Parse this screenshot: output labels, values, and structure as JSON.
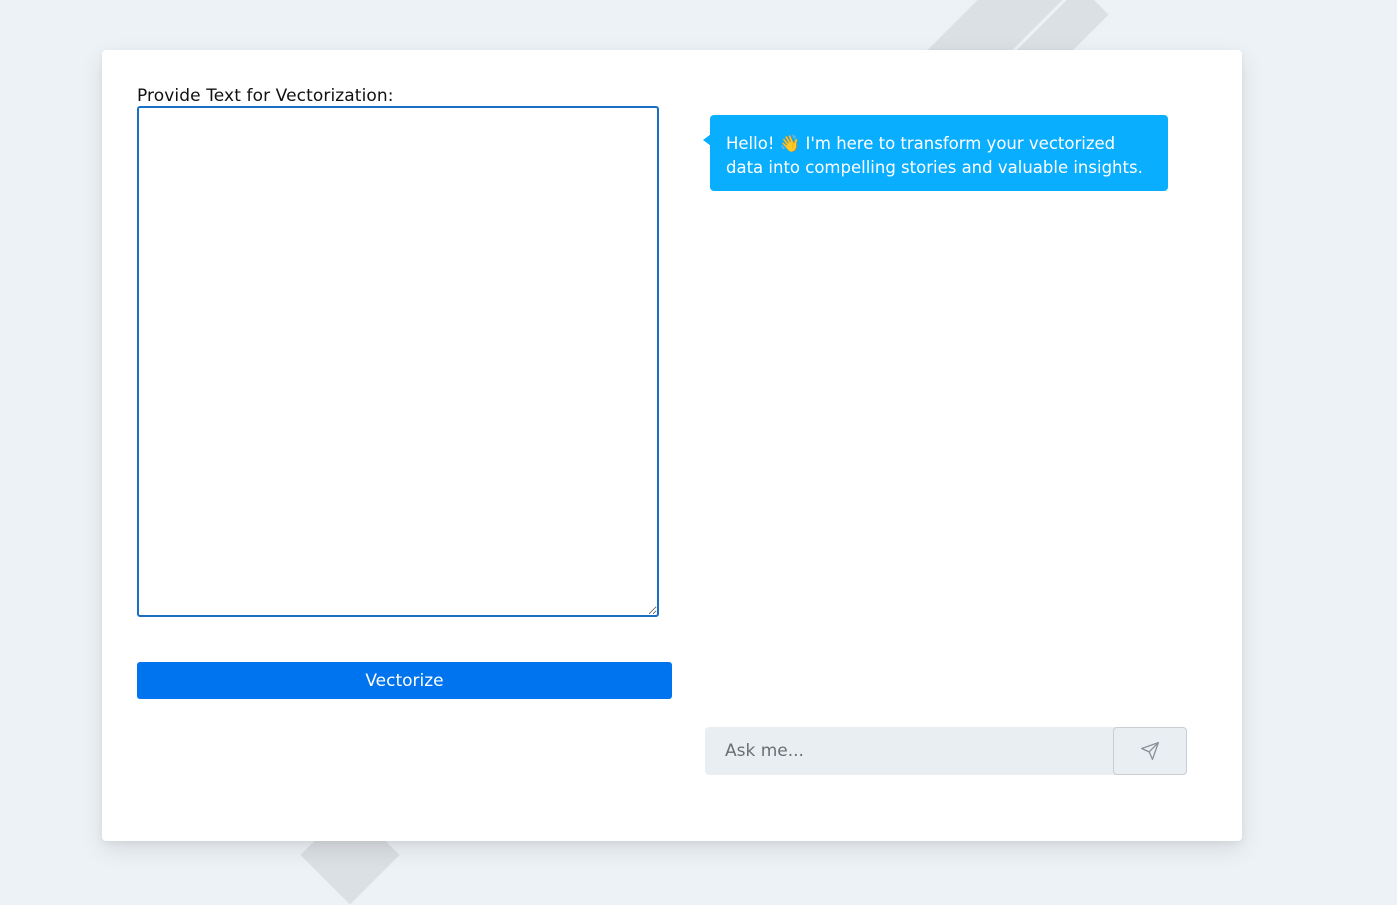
{
  "vectorize_panel": {
    "label": "Provide Text for Vectorization:",
    "textarea_value": "",
    "button_label": "Vectorize"
  },
  "chat": {
    "messages": [
      {
        "role": "assistant",
        "text": "Hello! 👋 I'm here to transform your vectorized data into compelling stories and valuable insights."
      }
    ],
    "input_value": "",
    "input_placeholder": "Ask me...",
    "send_icon": "send-icon"
  },
  "colors": {
    "accent": "#0073ee",
    "bubble": "#0aaeff",
    "textarea_border": "#1a6fc4",
    "page_background": "#edf2f6"
  }
}
